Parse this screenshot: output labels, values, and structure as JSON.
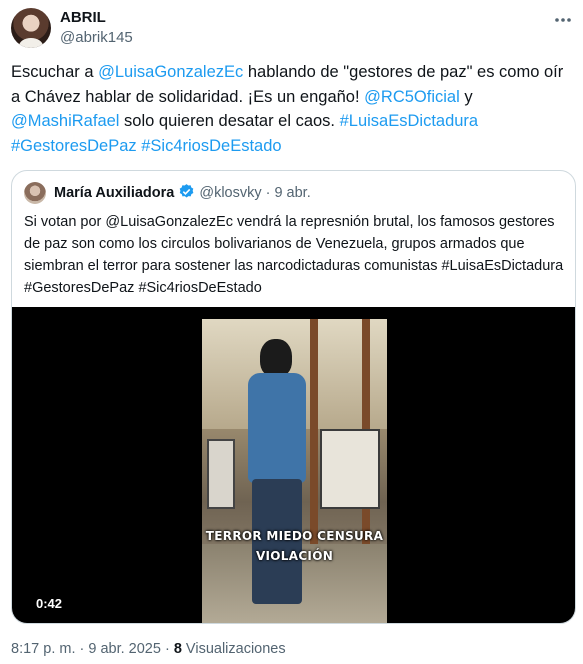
{
  "tweet": {
    "author_name": "ABRIL",
    "author_handle": "@abrik145",
    "more_icon": "more-horizontal-icon",
    "text": {
      "t1": "Escuchar a ",
      "m1": "@LuisaGonzalezEc",
      "t2": " hablando de \"gestores de paz\" es como oír a Chávez hablar de solidaridad. ¡Es un engaño! ",
      "m2": "@RC5Oficial",
      "t3": " y ",
      "m3": "@MashiRafael",
      "t4": " solo quieren desatar el caos. ",
      "h1": "#LuisaEsDictadura",
      "sp1": " ",
      "h2": "#GestoresDePaz",
      "sp2": " ",
      "h3": "#Sic4riosDeEstado"
    },
    "link_color": "#1d9bf0"
  },
  "quoted": {
    "author_name": "María Auxiliadora",
    "verified_icon": "verified-badge-icon",
    "author_handle": "@klosvky",
    "dot": "·",
    "date": "9 abr.",
    "text": "Si votan por @LuisaGonzalezEc vendrá la represnión brutal, los famosos gestores de paz son como los circulos bolivarianos de Venezuela, grupos armados que siembran el terror para sostener las narcodictaduras comunistas #LuisaEsDictadura #GestoresDePaz #Sic4riosDeEstado",
    "video": {
      "caption_line1": "TERROR MIEDO CENSURA",
      "caption_line2": "VIOLACIÓN",
      "duration": "0:42"
    }
  },
  "footer": {
    "timestamp": "8:17 p. m. · 9 abr. 2025 · ",
    "views_count": "8",
    "views_label": " Visualizaciones"
  }
}
